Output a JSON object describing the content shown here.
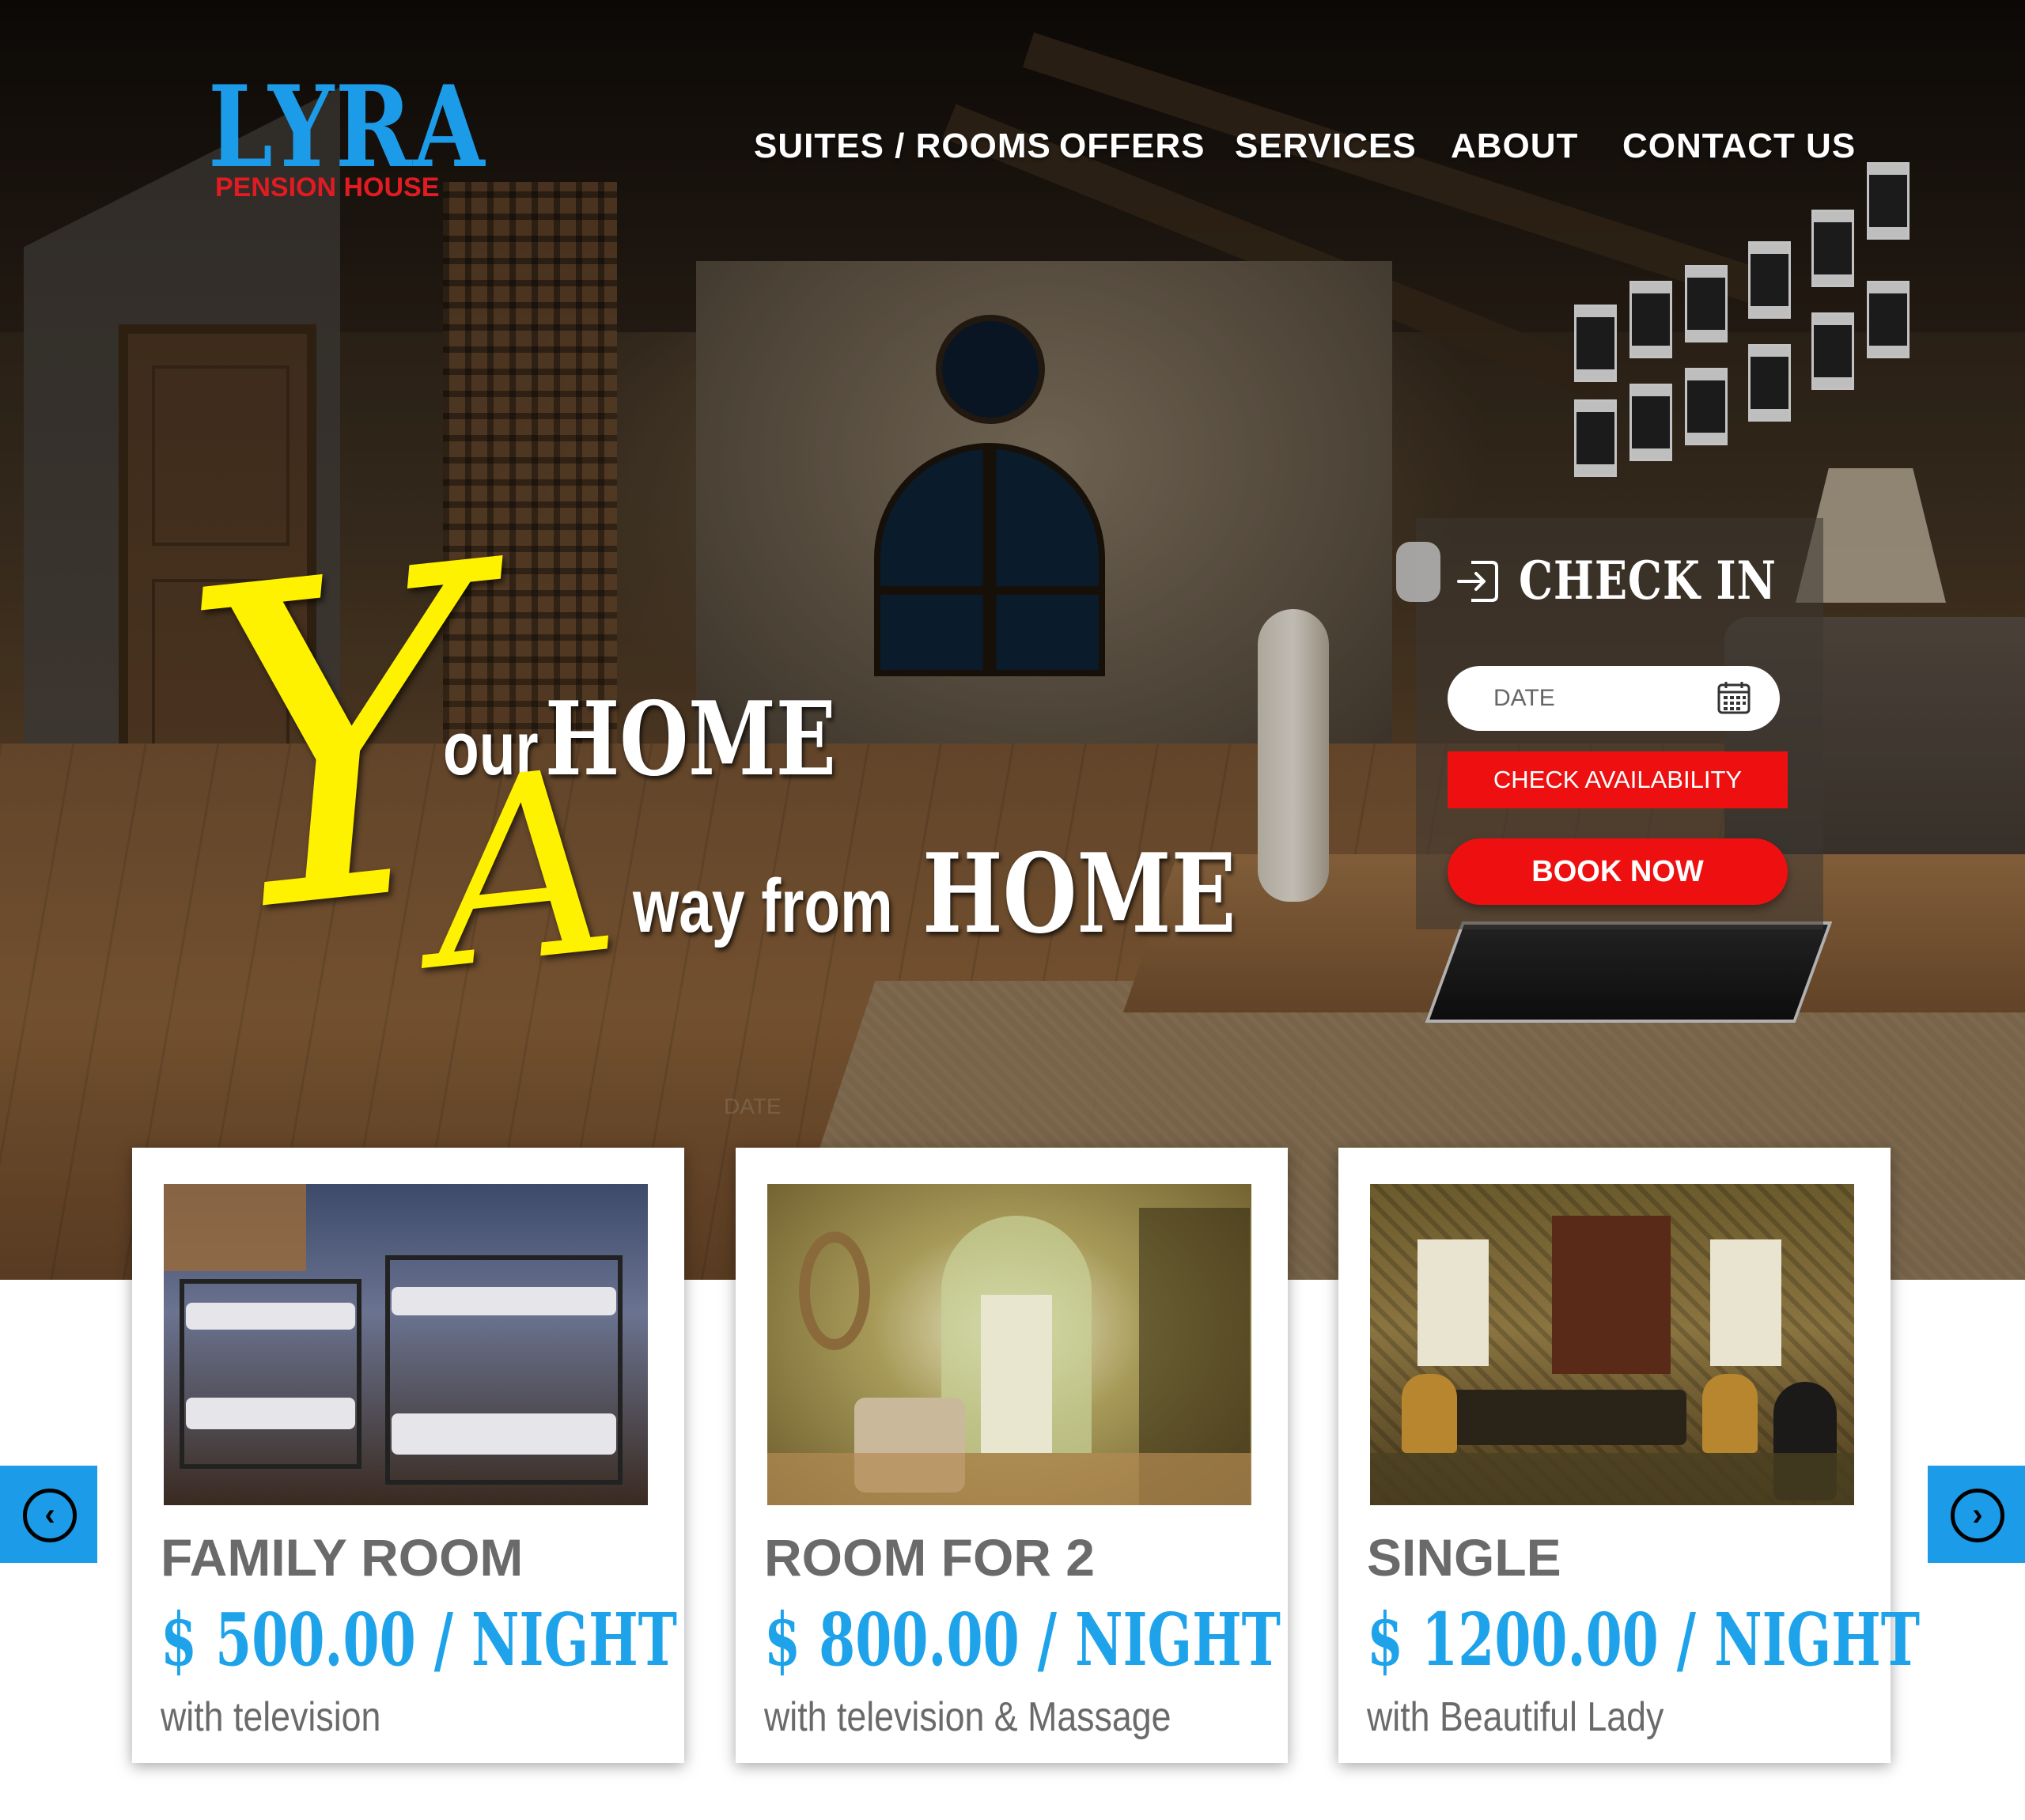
{
  "brand": {
    "name": "LYRA",
    "subtitle": "PENSION HOUSE",
    "primary_color": "#1c9be8",
    "accent_color": "#e11b22"
  },
  "nav": {
    "items": [
      {
        "label": "SUITES / ROOMS"
      },
      {
        "label": "OFFERS"
      },
      {
        "label": "SERVICES"
      },
      {
        "label": "ABOUT"
      },
      {
        "label": "CONTACT US"
      }
    ]
  },
  "hero": {
    "script_initial_1": "Y",
    "line1_sans": "our",
    "line1_serif": "HOME",
    "script_initial_2": "A",
    "line2_sans": "way from",
    "line2_serif": "HOME",
    "headline_color": "#fff200"
  },
  "checkin": {
    "title": "CHECK IN",
    "date_placeholder": "DATE",
    "check_label": "CHECK AVAILABILITY",
    "book_label": "BOOK NOW",
    "button_color": "#ee1010"
  },
  "ghost_text": "DATE",
  "rooms": [
    {
      "name": "FAMILY ROOM",
      "price": "$ 500.00 / NIGHT",
      "description": "with television"
    },
    {
      "name": "ROOM FOR 2",
      "price": "$ 800.00 / NIGHT",
      "description": "with television & Massage"
    },
    {
      "name": "SINGLE",
      "price": "$ 1200.00 / NIGHT",
      "description": "with Beautiful Lady"
    }
  ],
  "carousel": {
    "prev_icon": "chevron-left-icon",
    "next_icon": "chevron-right-icon",
    "prev_glyph": "‹",
    "next_glyph": "›"
  }
}
